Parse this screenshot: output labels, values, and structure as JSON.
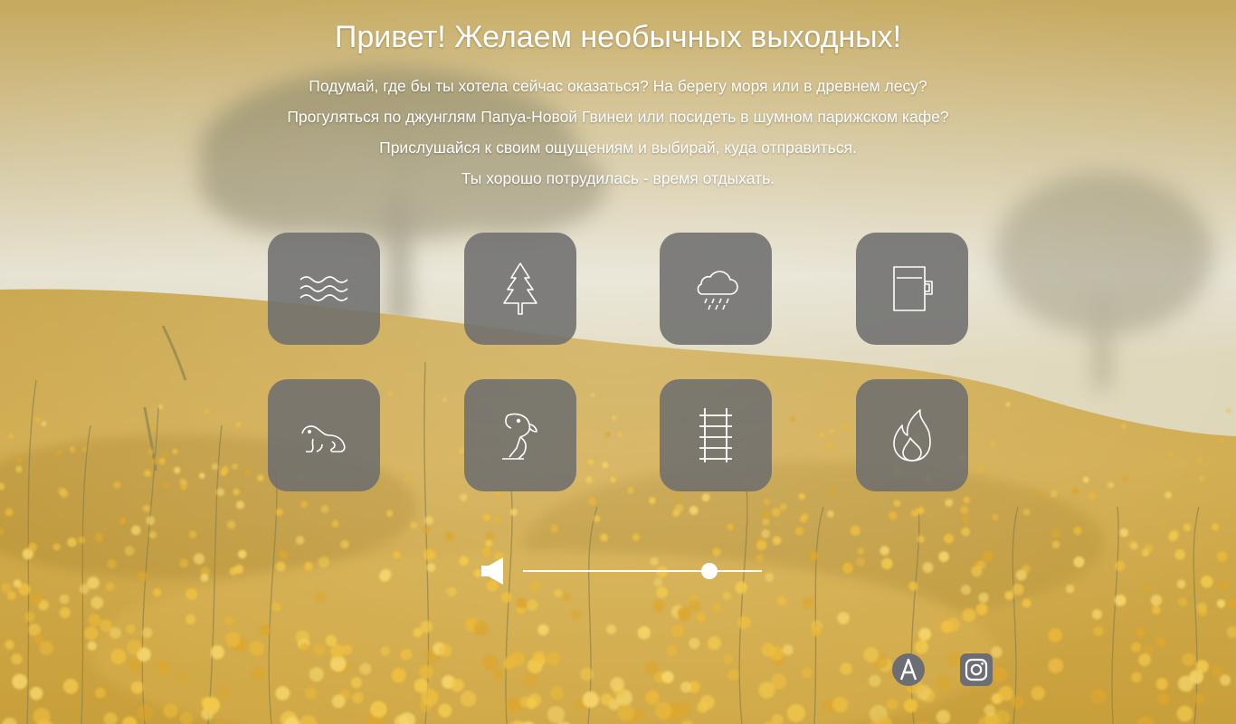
{
  "page": {
    "title": "Привет! Желаем необычных выходных!",
    "intro": [
      "Подумай, где бы ты хотела сейчас оказаться? На берегу моря или в древнем лесу?",
      "Прогуляться по джунглям Папуа-Новой Гвинеи или посидеть в шумном парижском кафе?",
      "Прислушайся к своим ощущениям и выбирай, куда отправиться.",
      "Ты хорошо потрудилась - время отдыхать."
    ]
  },
  "sounds": [
    {
      "icon": "waves-icon"
    },
    {
      "icon": "pine-tree-icon"
    },
    {
      "icon": "rain-cloud-icon"
    },
    {
      "icon": "coffee-mug-icon"
    },
    {
      "icon": "frog-icon"
    },
    {
      "icon": "parrot-icon"
    },
    {
      "icon": "railway-track-icon"
    },
    {
      "icon": "fire-icon"
    }
  ],
  "volume": {
    "icon": "speaker-icon",
    "level": 0.78
  },
  "social": [
    {
      "icon": "a-logo-icon"
    },
    {
      "icon": "instagram-icon"
    }
  ],
  "colors": {
    "tile": "#6e6e6e",
    "text": "#ffffff",
    "field": "#d9b24a",
    "sky": "#e4dfcc"
  }
}
